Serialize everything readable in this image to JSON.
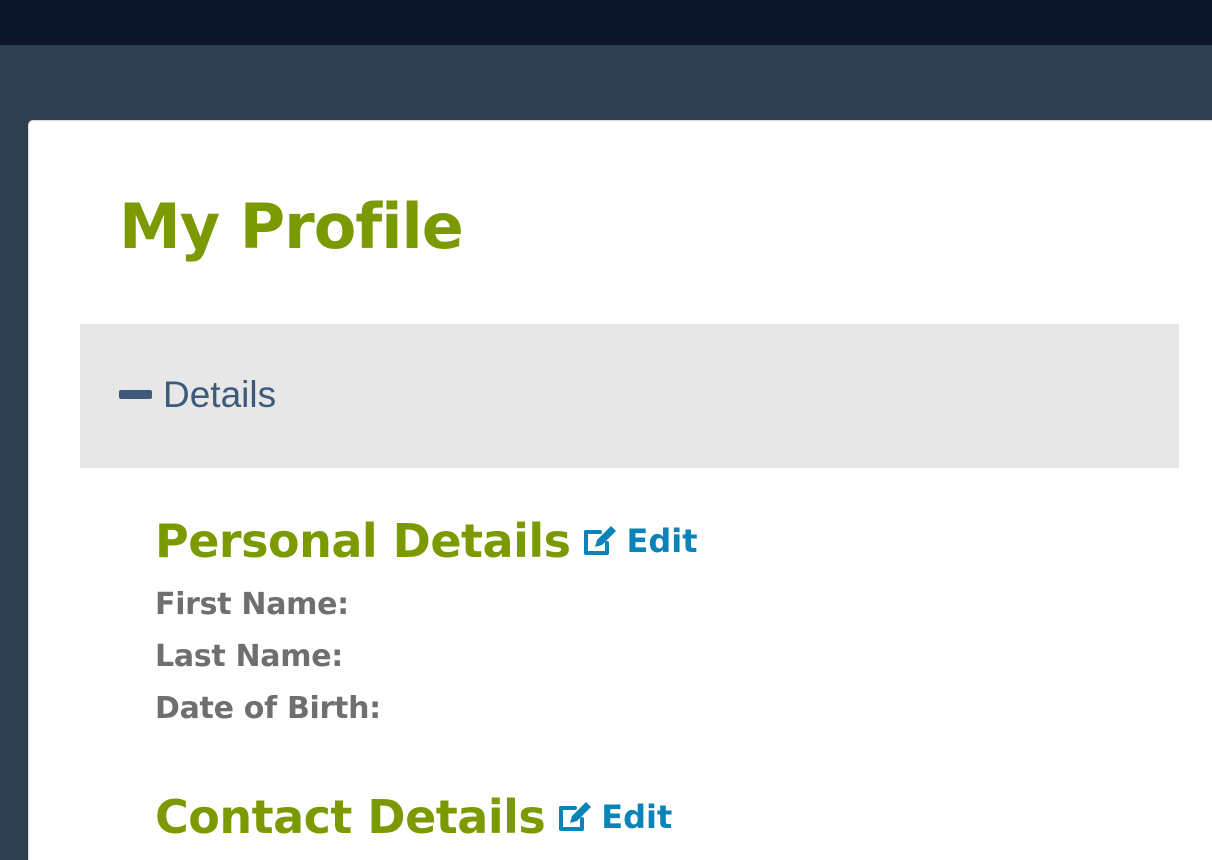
{
  "page": {
    "title": "My Profile"
  },
  "accordion": {
    "label": "Details",
    "state": "expanded"
  },
  "sections": {
    "personal": {
      "title": "Personal Details",
      "edit_label": "Edit",
      "fields": [
        "First Name:",
        "Last Name:",
        "Date of Birth:"
      ]
    },
    "contact": {
      "title": "Contact Details",
      "edit_label": "Edit"
    }
  },
  "colors": {
    "topbar": "#0b162a",
    "backdrop": "#2e3f50",
    "title_green": "#7b9a00",
    "link_blue": "#0a84b8",
    "accordion_text": "#3d5a7a",
    "label_gray": "#6f6f6f",
    "accordion_bg": "#e7e7e7"
  },
  "icons": {
    "edit": "edit-pencil-square-icon",
    "collapse": "minus-icon"
  }
}
